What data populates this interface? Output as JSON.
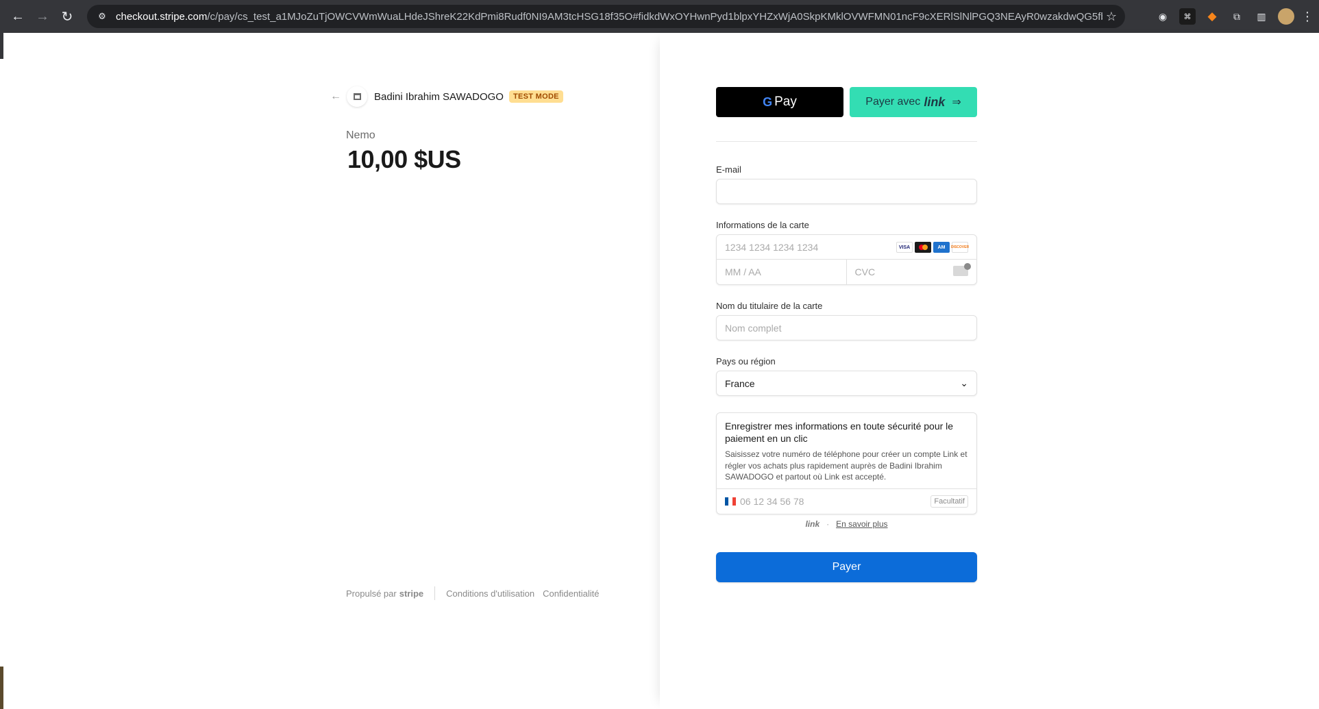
{
  "browser": {
    "url_host": "checkout.stripe.com",
    "url_rest": "/c/pay/cs_test_a1MJoZuTjOWCVWmWuaLHdeJShreK22KdPmi8Rudf0NI9AM3tcHSG18f35O#fidkdWxOYHwnPyd1blpxYHZxWjA0SkpKMklOVWFMN01ncF9cXERlSlNlPGQ3NEAyR0wzakdwQG5fbX9q...",
    "icons": {
      "back": "←",
      "forward": "→",
      "reload": "↻",
      "site_settings": "⚙",
      "star": "☆"
    }
  },
  "merchant": {
    "name": "Badini Ibrahim SAWADOGO",
    "badge": "TEST MODE"
  },
  "product": {
    "name": "Nemo",
    "price": "10,00 $US"
  },
  "footer": {
    "powered_by": "Propulsé par",
    "brand": "stripe",
    "terms": "Conditions d'utilisation",
    "privacy": "Confidentialité"
  },
  "wallets": {
    "gpay_label": "Pay",
    "link_label": "Payer avec",
    "link_brand": "link"
  },
  "form": {
    "email_label": "E-mail",
    "email_value": "",
    "card_label": "Informations de la carte",
    "card_number_placeholder": "1234 1234 1234 1234",
    "expiry_placeholder": "MM / AA",
    "cvc_placeholder": "CVC",
    "cardholder_label": "Nom du titulaire de la carte",
    "cardholder_placeholder": "Nom complet",
    "country_label": "Pays ou région",
    "country_value": "France",
    "link_title": "Enregistrer mes informations en toute sécurité pour le paiement en un clic",
    "link_desc": "Saisissez votre numéro de téléphone pour créer un compte Link et régler vos achats plus rapidement auprès de Badini Ibrahim SAWADOGO et partout où Link est accepté.",
    "phone_placeholder": "06 12 34 56 78",
    "optional": "Facultatif",
    "link_logo": "link",
    "learn_more": "En savoir plus",
    "pay_button": "Payer"
  },
  "colors": {
    "pay_button": "#0c6cd9",
    "link_button": "#33ddb3",
    "test_badge_bg": "#ffde92",
    "test_badge_text": "#a04b00"
  }
}
